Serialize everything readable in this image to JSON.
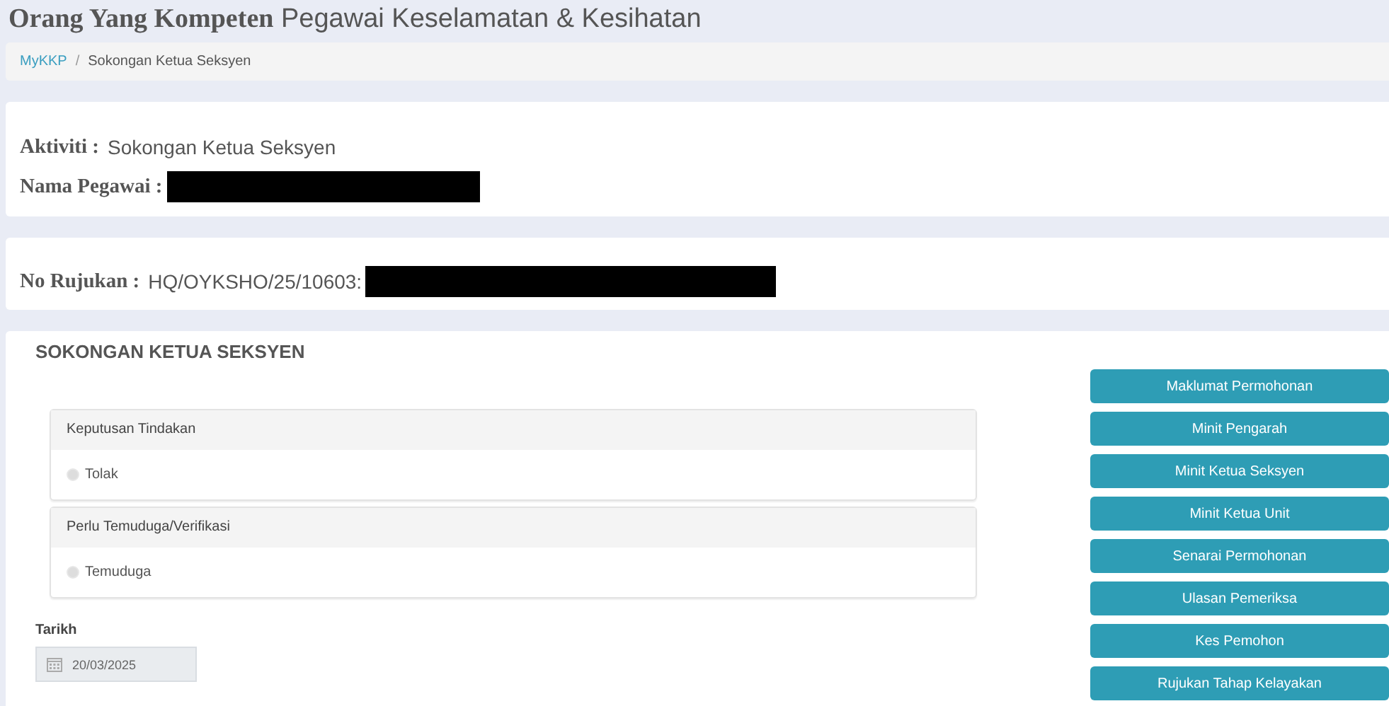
{
  "page_title": {
    "bold": "Orang Yang Kompeten",
    "rest": "Pegawai Keselamatan & Kesihatan"
  },
  "breadcrumb_separator": "/",
  "breadcrumb": [
    {
      "label": "MyKKP",
      "link": true
    },
    {
      "label": "Sokongan Ketua Seksyen",
      "link": false
    }
  ],
  "info_card": [
    {
      "label": "Aktiviti :",
      "value": "Sokongan Ketua Seksyen",
      "redacted": false
    },
    {
      "label": "Nama Pegawai :",
      "redacted": true
    }
  ],
  "reference": {
    "label": "No Rujukan :",
    "value": "HQ/OYKSHO/25/10603:",
    "redacted": true
  },
  "section": {
    "title": "SOKONGAN KETUA SEKSYEN",
    "groups": [
      {
        "title": "Keputusan Tindakan",
        "options": [
          {
            "label": "Tolak",
            "selected": false
          }
        ]
      },
      {
        "title": "Perlu Temuduga/Verifikasi",
        "options": [
          {
            "label": "Temuduga",
            "selected": false
          }
        ]
      }
    ],
    "date": {
      "label": "Tarikh",
      "value": "20/03/2025",
      "disabled": true
    },
    "buttons": [
      "Maklumat Permohonan",
      "Minit Pengarah",
      "Minit Ketua Seksyen",
      "Minit Ketua Unit",
      "Senarai Permohonan",
      "Ulasan Pemeriksa",
      "Kes Pemohon",
      "Rujukan Tahap Kelayakan"
    ]
  }
}
